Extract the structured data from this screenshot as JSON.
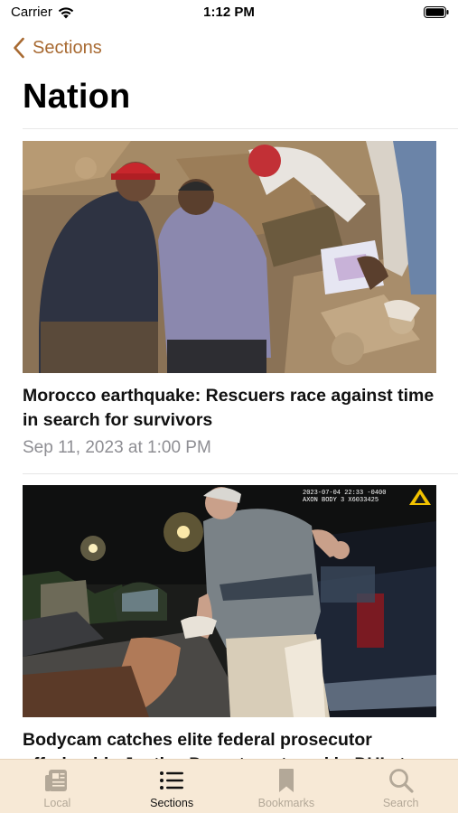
{
  "status_bar": {
    "carrier": "Carrier",
    "time": "1:12 PM"
  },
  "nav": {
    "back_label": "Sections",
    "accent_color": "#a86a32"
  },
  "page": {
    "title": "Nation"
  },
  "articles": [
    {
      "headline": "Morocco earthquake: Rescuers race against time in search for survivors",
      "timestamp": "Sep 11, 2023 at 1:00 PM"
    },
    {
      "headline": "Bodycam catches elite federal prosecutor offering his Justice Department card in DUI stop",
      "timestamp": "",
      "image_overlay_text": "2023-07-04 22:33 -0400\nAXON BODY 3 X6033425"
    }
  ],
  "tab_bar": {
    "background": "#f7e9d6",
    "active_tab": "Sections",
    "tabs": [
      {
        "label": "Local",
        "icon": "newspaper-icon"
      },
      {
        "label": "Sections",
        "icon": "list-icon"
      },
      {
        "label": "Bookmarks",
        "icon": "bookmark-icon"
      },
      {
        "label": "Search",
        "icon": "search-icon"
      }
    ]
  }
}
